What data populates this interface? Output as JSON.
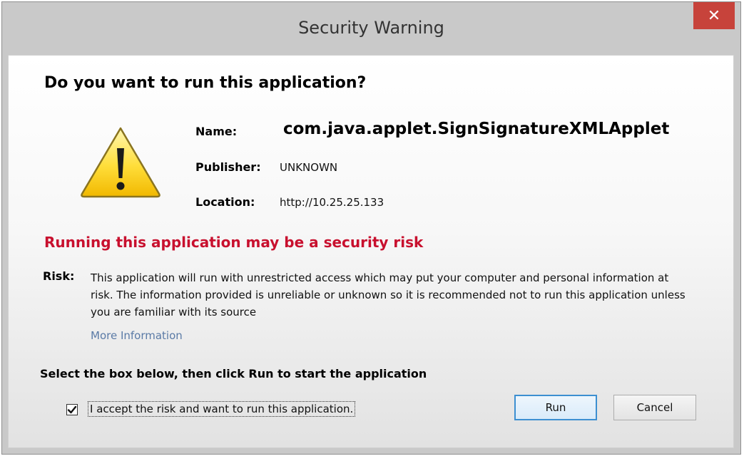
{
  "window": {
    "title": "Security Warning",
    "close_glyph": "✕"
  },
  "dialog": {
    "question": "Do you want to run this application?",
    "icon": "warning-icon",
    "name_label": "Name:",
    "name_value": "com.java.applet.SignSignatureXMLApplet",
    "publisher_label": "Publisher:",
    "publisher_value": "UNKNOWN",
    "location_label": "Location:",
    "location_value": "http://10.25.25.133",
    "risk_heading": "Running this application may be a security risk",
    "risk_label": "Risk:",
    "risk_text": "This application will run with unrestricted access which may put your computer and personal information at risk. The information provided is unreliable or unknown so it is recommended not to run this application unless you are familiar with its source",
    "more_info_link": "More Information",
    "select_instruction": "Select the box below, then click Run to start the application",
    "accept_label": "I accept the risk and want to run this application.",
    "accept_checked": true
  },
  "buttons": {
    "run_label": "Run",
    "cancel_label": "Cancel"
  },
  "colors": {
    "risk_heading": "#c8102e",
    "close_button": "#c7433b",
    "link": "#5a7aa6",
    "default_button_border": "#3c8fd1"
  }
}
